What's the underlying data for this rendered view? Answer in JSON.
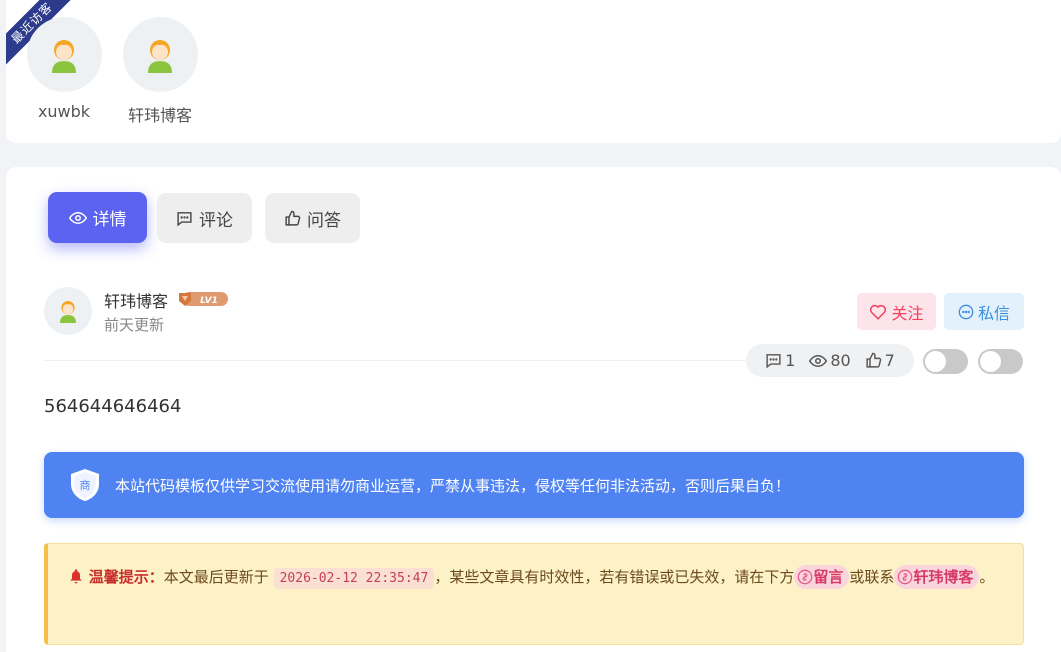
{
  "visitors": {
    "ribbon_label": "最近访客",
    "items": [
      {
        "name": "xuwbk"
      },
      {
        "name": "轩玮博客"
      }
    ]
  },
  "tabs": [
    {
      "label": "详情",
      "icon": "eye-icon",
      "active": true
    },
    {
      "label": "评论",
      "icon": "comment-icon",
      "active": false
    },
    {
      "label": "问答",
      "icon": "thumbs-up-icon",
      "active": false
    }
  ],
  "author": {
    "name": "轩玮博客",
    "level": "LV1",
    "updated": "前天更新",
    "follow_label": "关注",
    "message_label": "私信"
  },
  "stats": {
    "comments": "1",
    "views": "80",
    "likes": "7"
  },
  "content": {
    "text": "564644646464"
  },
  "notice": {
    "shield_text": "商",
    "text": "本站代码模板仅供学习交流使用请勿商业运营，严禁从事违法，侵权等任何非法活动，否则后果自负！"
  },
  "tip": {
    "title": "温馨提示：",
    "part1": "本文最后更新于",
    "date": "2026-02-12 22:35:47",
    "part2": "，某些文章具有时效性，若有错误或已失效，请在下方",
    "link1": "留言",
    "part3": "或联系",
    "link2": "轩玮博客",
    "part4": "。"
  },
  "colors": {
    "accent": "#5b63f0",
    "notice_bg": "#5083f2",
    "follow": "#f0405d",
    "message": "#3d8ee0",
    "ribbon": "#2d3b8c"
  }
}
